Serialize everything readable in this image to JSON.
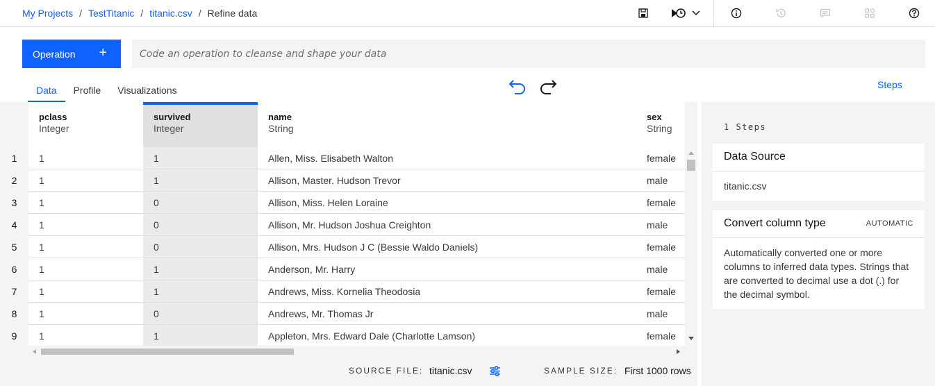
{
  "breadcrumb": {
    "items": [
      "My Projects",
      "TestTitanic",
      "titanic.csv"
    ],
    "current": "Refine data",
    "separator": "/"
  },
  "toolbar": {
    "icons": [
      "save-icon",
      "schedule-job-icon",
      "chevron-down-icon",
      "info-icon",
      "history-icon",
      "comment-icon",
      "integrations-icon",
      "help-icon"
    ]
  },
  "operation": {
    "button_label": "Operation",
    "plus": "+",
    "placeholder": "Code an operation to cleanse and shape your data"
  },
  "tabs": [
    "Data",
    "Profile",
    "Visualizations"
  ],
  "steps_link": "Steps",
  "columns": [
    {
      "name": "pclass",
      "type": "Integer"
    },
    {
      "name": "survived",
      "type": "Integer"
    },
    {
      "name": "name",
      "type": "String"
    },
    {
      "name": "sex",
      "type": "String"
    }
  ],
  "rows": [
    {
      "n": "1",
      "pclass": "1",
      "survived": "1",
      "name": "Allen, Miss. Elisabeth Walton",
      "sex": "female"
    },
    {
      "n": "2",
      "pclass": "1",
      "survived": "1",
      "name": "Allison, Master. Hudson Trevor",
      "sex": "male"
    },
    {
      "n": "3",
      "pclass": "1",
      "survived": "0",
      "name": "Allison, Miss. Helen Loraine",
      "sex": "female"
    },
    {
      "n": "4",
      "pclass": "1",
      "survived": "0",
      "name": "Allison, Mr. Hudson Joshua Creighton",
      "sex": "male"
    },
    {
      "n": "5",
      "pclass": "1",
      "survived": "0",
      "name": "Allison, Mrs. Hudson J C (Bessie Waldo Daniels)",
      "sex": "female"
    },
    {
      "n": "6",
      "pclass": "1",
      "survived": "1",
      "name": "Anderson, Mr. Harry",
      "sex": "male"
    },
    {
      "n": "7",
      "pclass": "1",
      "survived": "1",
      "name": "Andrews, Miss. Kornelia Theodosia",
      "sex": "female"
    },
    {
      "n": "8",
      "pclass": "1",
      "survived": "0",
      "name": "Andrews, Mr. Thomas Jr",
      "sex": "male"
    },
    {
      "n": "9",
      "pclass": "1",
      "survived": "1",
      "name": "Appleton, Mrs. Edward Dale (Charlotte Lamson)",
      "sex": "female"
    }
  ],
  "footer": {
    "source_label": "SOURCE FILE:",
    "source_value": "titanic.csv",
    "sample_label": "SAMPLE SIZE:",
    "sample_value": "First 1000 rows"
  },
  "steps_panel": {
    "count": "1 Steps",
    "cards": [
      {
        "title": "Data Source",
        "body": "titanic.csv"
      },
      {
        "title": "Convert column type",
        "tag": "AUTOMATIC",
        "body": "Automatically converted one or more columns to inferred data types. Strings that are converted to decimal use a dot (.) for the decimal symbol."
      }
    ]
  },
  "colors": {
    "accent": "#0f62fe",
    "panel_bg": "#f4f4f4"
  }
}
